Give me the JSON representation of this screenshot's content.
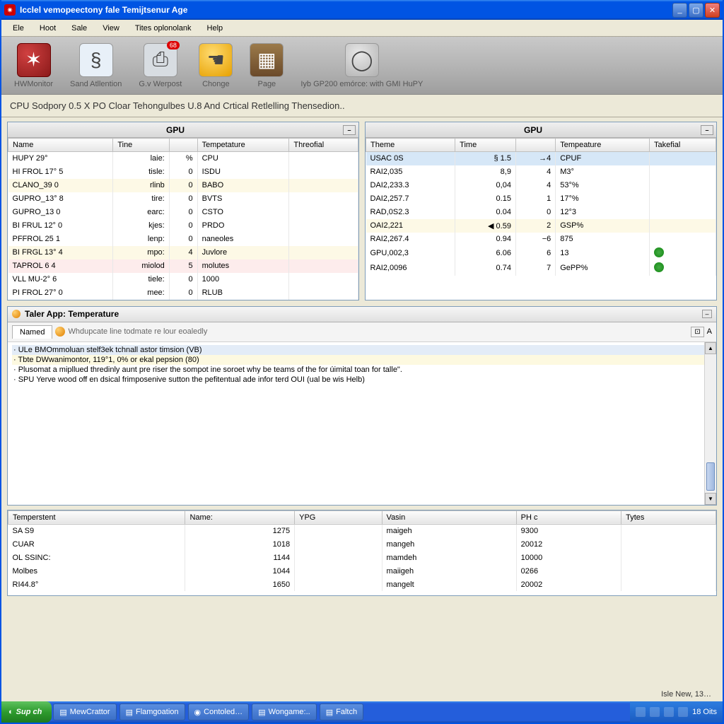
{
  "titlebar": {
    "title": "Icclel vemopeectony fale Temijtsenur Age"
  },
  "menu": [
    "Ele",
    "Hoot",
    "Sale",
    "View",
    "Tites oplonolank",
    "Help"
  ],
  "toolbar": [
    {
      "label": "HWMonitor",
      "badge": ""
    },
    {
      "label": "Sand Atllention",
      "badge": ""
    },
    {
      "label": "G.v Werpost",
      "badge": "68"
    },
    {
      "label": "Chonge",
      "badge": ""
    },
    {
      "label": "Page",
      "badge": ""
    },
    {
      "label": "Iyb GP200 emórce: with GMI HuPY",
      "badge": ""
    }
  ],
  "statusline": "CPU Sodpory 0.5 X PO Cloar Tehongulbes U.8 And Crtical Retlelling Thensedion..",
  "left": {
    "title": "GPU",
    "cols": [
      "Name",
      "Tine",
      "",
      "Tempetature",
      "Threofial"
    ],
    "rows": [
      [
        "HUPY      29°",
        "laie:",
        "%",
        "CPU",
        ""
      ],
      [
        "HI FROL 17°  5",
        "tisle:",
        "0",
        "ISDU",
        ""
      ],
      [
        "CLANO_39   0",
        "rlinb",
        "0",
        "BABO",
        ""
      ],
      [
        "GUPRO_13°  8",
        "tire:",
        "0",
        "BVTS",
        ""
      ],
      [
        "GUPRO_13   0",
        "earc:",
        "0",
        "CSTO",
        ""
      ],
      [
        "BI FRUL 12°  0",
        "kjes:",
        "0",
        "PRDO",
        ""
      ],
      [
        "PFFROL 25   1",
        "lenp:",
        "0",
        "naneoles",
        ""
      ],
      [
        "BI FRGL 13°  4",
        "mpo:",
        "4",
        "Juvlore",
        ""
      ],
      [
        "TAPROL 6    4",
        "miolod",
        "5",
        "molutes",
        ""
      ],
      [
        "VLL MU-2°   6",
        "tiele:",
        "0",
        "1000",
        ""
      ],
      [
        "PI FROL 27°  0",
        "mee:",
        "0",
        "RLUB",
        ""
      ]
    ],
    "rowstyles": [
      "",
      "",
      "alt",
      "",
      "",
      "",
      "",
      "alt",
      "alt2",
      "",
      ""
    ]
  },
  "right": {
    "title": "GPU",
    "cols": [
      "Theme",
      "Time",
      "",
      "Tempeature",
      "Takefial"
    ],
    "rows": [
      [
        "USAC 0S",
        "§ 1.5",
        "→4",
        "CPUF",
        ""
      ],
      [
        "RAI2,035",
        "8,9",
        "4",
        "M3°",
        ""
      ],
      [
        "DAI2,233.3",
        "0,04",
        "4",
        "53°%",
        ""
      ],
      [
        "DAI2,257.7",
        "0.15",
        "1",
        "17°%",
        ""
      ],
      [
        "RAD,0S2.3",
        "0.04",
        "0",
        "12°3",
        ""
      ],
      [
        "OAI2,221",
        "◀ 0.59",
        "2",
        "GSP%",
        ""
      ],
      [
        "RAI2,267.4",
        "0.94",
        "−6",
        "875",
        ""
      ],
      [
        "GPU,002,3",
        "6.06",
        "6",
        "13",
        "gear"
      ],
      [
        "RAI2,0096",
        "0.74",
        "7",
        "GePP%",
        "gear"
      ]
    ],
    "rowstyles": [
      "sel",
      "",
      "",
      "",
      "",
      "alt",
      "",
      "",
      ""
    ]
  },
  "log": {
    "title": "Taler App: Temperature",
    "tab": "Named",
    "hint": "Whdupcate line todmate re lour eoaledly",
    "endA": "A",
    "lines": [
      {
        "t": "SPU Yerve wood off en dsical frimposenive sutton the pefitentual ade infor terd OUI (ual be wis Helb)",
        "s": ""
      },
      {
        "t": "Plusomat a mipllued thredinly aunt pre riser the sompot ine soroet why be teams of the for úimital toan for talle\".",
        "s": ""
      },
      {
        "t": "Tbte DWwanimontor, 119°1, 0% or ekal pepsion (80)",
        "s": "h1"
      },
      {
        "t": "ULe BMOmmoluan stelf3ek tchnall astor timsion (VB)",
        "s": "h2"
      }
    ]
  },
  "bottom": {
    "cols": [
      "Temperstent",
      "Name:",
      "YPG",
      "Vasin",
      "PH c",
      "Tytes"
    ],
    "rows": [
      [
        "SA S9",
        "1275",
        "",
        "maigeh",
        "9300",
        ""
      ],
      [
        "CUAR",
        "1018",
        "",
        "mangeh",
        "20012",
        ""
      ],
      [
        "OL SSINC:",
        "1144",
        "",
        "mamdeh",
        "10000",
        ""
      ],
      [
        "Molbes",
        "1044",
        "",
        "maiigeh",
        "0266",
        ""
      ],
      [
        "RI44.8°",
        "1650",
        "",
        "mangelt",
        "20002",
        ""
      ]
    ]
  },
  "tasks": [
    "MewCrattor",
    "Flamgoation",
    "Contoled…",
    "Wongame:..",
    "Faltch"
  ],
  "tray_hint": "Isle New, 13…",
  "tray_time": "18 Oits",
  "start": "Sup ch"
}
